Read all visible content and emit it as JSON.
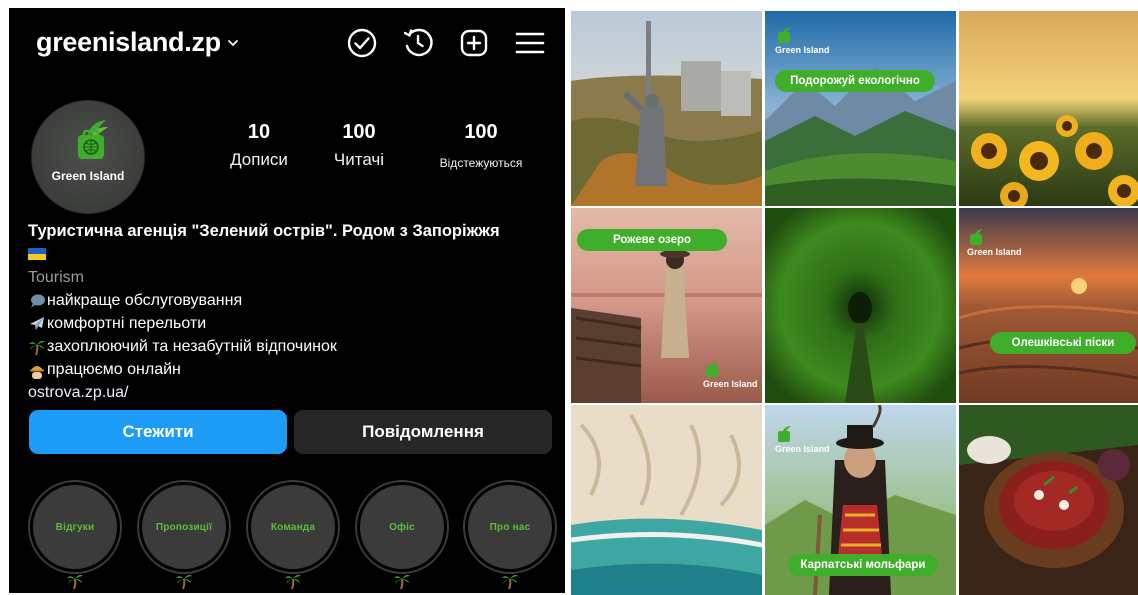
{
  "profile": {
    "username": "greenisland.zp",
    "avatar_text": "Green Island",
    "stats": [
      {
        "value": "10",
        "label": "Дописи"
      },
      {
        "value": "100",
        "label": "Читачі"
      },
      {
        "value": "100",
        "label": "Відстежуються"
      }
    ],
    "bio": {
      "title": "Туристична агенція \"Зелений острів\". Родом з Запоріжжя",
      "category": "Tourism",
      "lines": [
        "найкраще обслуговування",
        "комфортні перельоти",
        "захоплюючий та незабутній відпочинок",
        "працюємо онлайн"
      ],
      "link": "ostrova.zp.ua/"
    },
    "buttons": {
      "follow": "Стежити",
      "message": "Повідомлення"
    },
    "highlights": [
      "Відгуки",
      "Пропозиції",
      "Команда",
      "Офіс",
      "Про нас"
    ]
  },
  "icons": {
    "top": [
      "chevron-down-icon",
      "verified-check-icon",
      "history-icon",
      "add-post-icon",
      "menu-icon"
    ],
    "bio": [
      "speech-bubble-icon",
      "airplane-icon",
      "palm-tree-icon",
      "worker-icon"
    ],
    "flag": "ukraine-flag-icon"
  },
  "colors": {
    "background": "#000000",
    "follow_button": "#1c9cf6",
    "message_button": "#262626",
    "brand_green": "#3fae2a",
    "highlight_text": "#5bbf3a",
    "category_text": "#9b9b9b"
  },
  "grid": {
    "tiles": [
      {
        "subject": "motherland-monument-kyiv"
      },
      {
        "subject": "carpathian-mountains",
        "brand": "Green Island",
        "caption": "Подорожуй екологічно"
      },
      {
        "subject": "sunflower-field"
      },
      {
        "subject": "pink-lake",
        "caption": "Рожеве озеро",
        "brand": "Green Island"
      },
      {
        "subject": "tunnel-of-love"
      },
      {
        "subject": "oleshky-sands",
        "brand": "Green Island",
        "caption": "Олешківські піски"
      },
      {
        "subject": "sea-shore"
      },
      {
        "subject": "carpathian-molfar",
        "brand": "Green Island",
        "caption": "Карпатські мольфари"
      },
      {
        "subject": "borscht-dish"
      }
    ]
  }
}
